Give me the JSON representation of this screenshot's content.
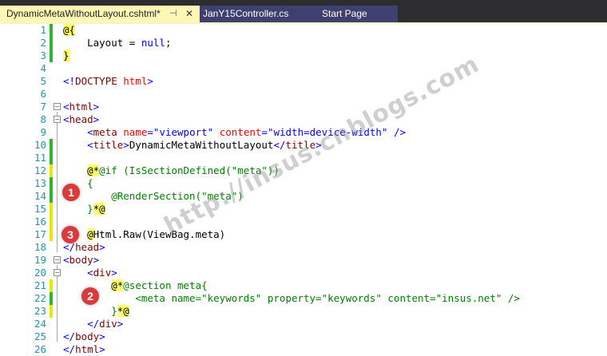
{
  "tabs": {
    "active": {
      "label": "DynamicMetaWithoutLayout.cshtml*",
      "pin": "⊣",
      "close": "✕"
    },
    "second": {
      "label": "JanY15Controller.cs"
    },
    "third": {
      "label": "Start Page"
    }
  },
  "lines": [
    {
      "n": "1"
    },
    {
      "n": "2"
    },
    {
      "n": "3"
    },
    {
      "n": "4"
    },
    {
      "n": "5"
    },
    {
      "n": "6"
    },
    {
      "n": "7"
    },
    {
      "n": "8"
    },
    {
      "n": "9"
    },
    {
      "n": "10"
    },
    {
      "n": "11"
    },
    {
      "n": "12"
    },
    {
      "n": "13"
    },
    {
      "n": "14"
    },
    {
      "n": "15"
    },
    {
      "n": "16"
    },
    {
      "n": "17"
    },
    {
      "n": "18"
    },
    {
      "n": "19"
    },
    {
      "n": "20"
    },
    {
      "n": "21"
    },
    {
      "n": "22"
    },
    {
      "n": "23"
    },
    {
      "n": "24"
    },
    {
      "n": "25"
    },
    {
      "n": "26"
    }
  ],
  "code": {
    "l1": {
      "at": "@{"
    },
    "l2": {
      "text": "    Layout = ",
      "null": "null",
      "end": ";"
    },
    "l3": {
      "brace": "}"
    },
    "l5": {
      "open": "<!",
      "name": "DOCTYPE",
      "attr": " html",
      "close": ">"
    },
    "l7": {
      "lt": "<",
      "tag": "html",
      "gt": ">"
    },
    "l8": {
      "lt": "<",
      "tag": "head",
      "gt": ">"
    },
    "l9": {
      "lt": "<",
      "tag": "meta",
      "a1": " name",
      "eq1": "=",
      "v1": "\"viewport\"",
      "a2": " content",
      "eq2": "=",
      "v2": "\"width=device-width\"",
      "end": " />"
    },
    "l10": {
      "lt": "<",
      "tag": "title",
      "gt": ">",
      "text": "DynamicMetaWithoutLayout",
      "lt2": "</",
      "tag2": "title",
      "gt2": ">"
    },
    "l12": {
      "start": "@*",
      "rest": "@if (IsSectionDefined(\"meta\"))"
    },
    "l13": {
      "text": "{"
    },
    "l14": {
      "text": "    @RenderSection(\"meta\")"
    },
    "l15": {
      "brace": "}",
      "end": "*@"
    },
    "l17": {
      "at": "@",
      "rest": "Html.Raw(ViewBag.meta)"
    },
    "l18": {
      "lt": "</",
      "tag": "head",
      "gt": ">"
    },
    "l19": {
      "lt": "<",
      "tag": "body",
      "gt": ">"
    },
    "l20": {
      "lt": "<",
      "tag": "div",
      "gt": ">"
    },
    "l21": {
      "start": "@*",
      "rest": "@section meta{"
    },
    "l22": {
      "text": "<meta name=\"keywords\" property=\"keywords\" content=\"insus.net\" />"
    },
    "l23": {
      "brace": "}",
      "end": "*@"
    },
    "l24": {
      "lt": "</",
      "tag": "div",
      "gt": ">"
    },
    "l25": {
      "lt": "</",
      "tag": "body",
      "gt": ">"
    },
    "l26": {
      "lt": "</",
      "tag": "html",
      "gt": ">"
    }
  },
  "badges": {
    "b1": "1",
    "b2": "2",
    "b3": "3"
  },
  "watermark": "http://insus.cnblogs.com",
  "colors": {
    "tag": "#800000",
    "attr": "#ff0000",
    "string": "#0000ff",
    "comment": "#008000",
    "linenum": "#2b91af",
    "highlight": "#ffff66",
    "badge": "#d93b3b",
    "change_green": "#32b432",
    "change_yellow": "#e8e800"
  }
}
